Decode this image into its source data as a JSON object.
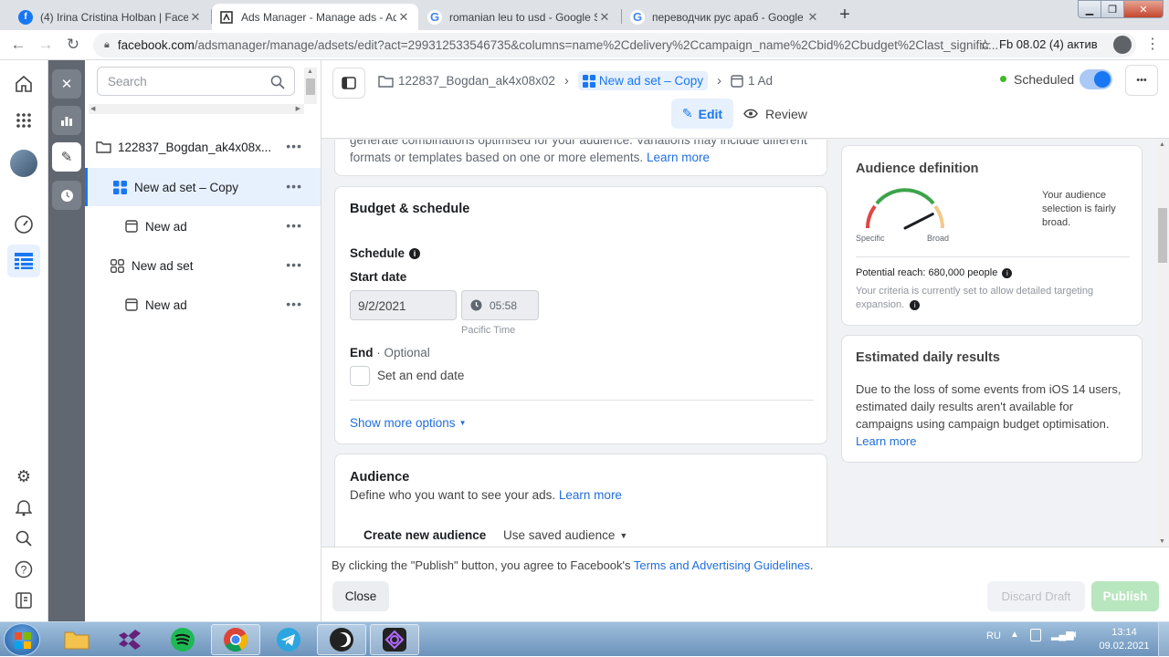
{
  "browser": {
    "tabs": [
      {
        "title": "(4) Irina Cristina Holban | Facebo",
        "icon": "facebook-icon",
        "active": false
      },
      {
        "title": "Ads Manager - Manage ads - Ad",
        "icon": "ads-manager-icon",
        "active": true
      },
      {
        "title": "romanian leu to usd - Google Se",
        "icon": "google-icon",
        "active": false
      },
      {
        "title": "переводчик рус араб - Google S",
        "icon": "google-icon",
        "active": false
      }
    ],
    "new_tab": "+",
    "url_host": "facebook.com",
    "url_rest": "/adsmanager/manage/adsets/edit?act=299312533546735&columns=name%2Cdelivery%2Ccampaign_name%2Cbid%2Cbudget%2Clast_signific...",
    "bookmark_label": "Fb 08.02 (4) актив"
  },
  "tree": {
    "search_placeholder": "Search",
    "items": [
      {
        "label": "122837_Bogdan_ak4x08x...",
        "icon": "campaign-folder-icon"
      },
      {
        "label": "New ad set – Copy",
        "icon": "ad-set-grid-icon",
        "selected": true
      },
      {
        "label": "New ad",
        "icon": "ad-icon"
      },
      {
        "label": "New ad set",
        "icon": "ad-set-grid-icon"
      },
      {
        "label": "New ad",
        "icon": "ad-icon"
      }
    ],
    "more": "•••"
  },
  "breadcrumb": {
    "campaign": "122837_Bogdan_ak4x08x02",
    "adset": "New ad set – Copy",
    "ads": "1 Ad",
    "status": "Scheduled",
    "more": "•••",
    "edit": "Edit",
    "review": "Review"
  },
  "top_card": {
    "line1": "generate combinations optimised for your audience. Variations may include different",
    "line2": "formats or templates based on one or more elements.",
    "learn_more": "Learn more"
  },
  "budget": {
    "title": "Budget & schedule",
    "schedule": "Schedule",
    "start_date_label": "Start date",
    "start_date": "9/2/2021",
    "start_time": "05:58",
    "timezone": "Pacific Time",
    "end_label": "End",
    "end_optional": "· Optional",
    "set_end_date": "Set an end date",
    "show_more": "Show more options"
  },
  "audience": {
    "title": "Audience",
    "subtitle": "Define who you want to see your ads.",
    "learn_more": "Learn more",
    "create_tab": "Create new audience",
    "saved_tab": "Use saved audience"
  },
  "audience_definition": {
    "title": "Audience definition",
    "description": "Your audience selection is fairly broad.",
    "specific": "Specific",
    "broad": "Broad",
    "gauge_level": 0.85,
    "potential_reach": "Potential reach: 680,000 people",
    "criteria_note": "Your criteria is currently set to allow detailed targeting expansion."
  },
  "estimated": {
    "title": "Estimated daily results",
    "body": "Due to the loss of some events from iOS 14 users, estimated daily results aren't available for campaigns using campaign budget optimisation.",
    "learn_more": "Learn more"
  },
  "footer": {
    "notice_pre": "By clicking the \"Publish\" button, you agree to Facebook's",
    "notice_link": "Terms and Advertising Guidelines",
    "notice_post": ".",
    "close": "Close",
    "discard": "Discard Draft",
    "publish": "Publish"
  },
  "taskbar": {
    "lang": "RU",
    "time": "13:14",
    "date": "09.02.2021"
  },
  "colors": {
    "accent": "#1877f2",
    "link": "#216fdb",
    "publish_bg": "#b8e6bf",
    "status_dot": "#42b72a"
  }
}
